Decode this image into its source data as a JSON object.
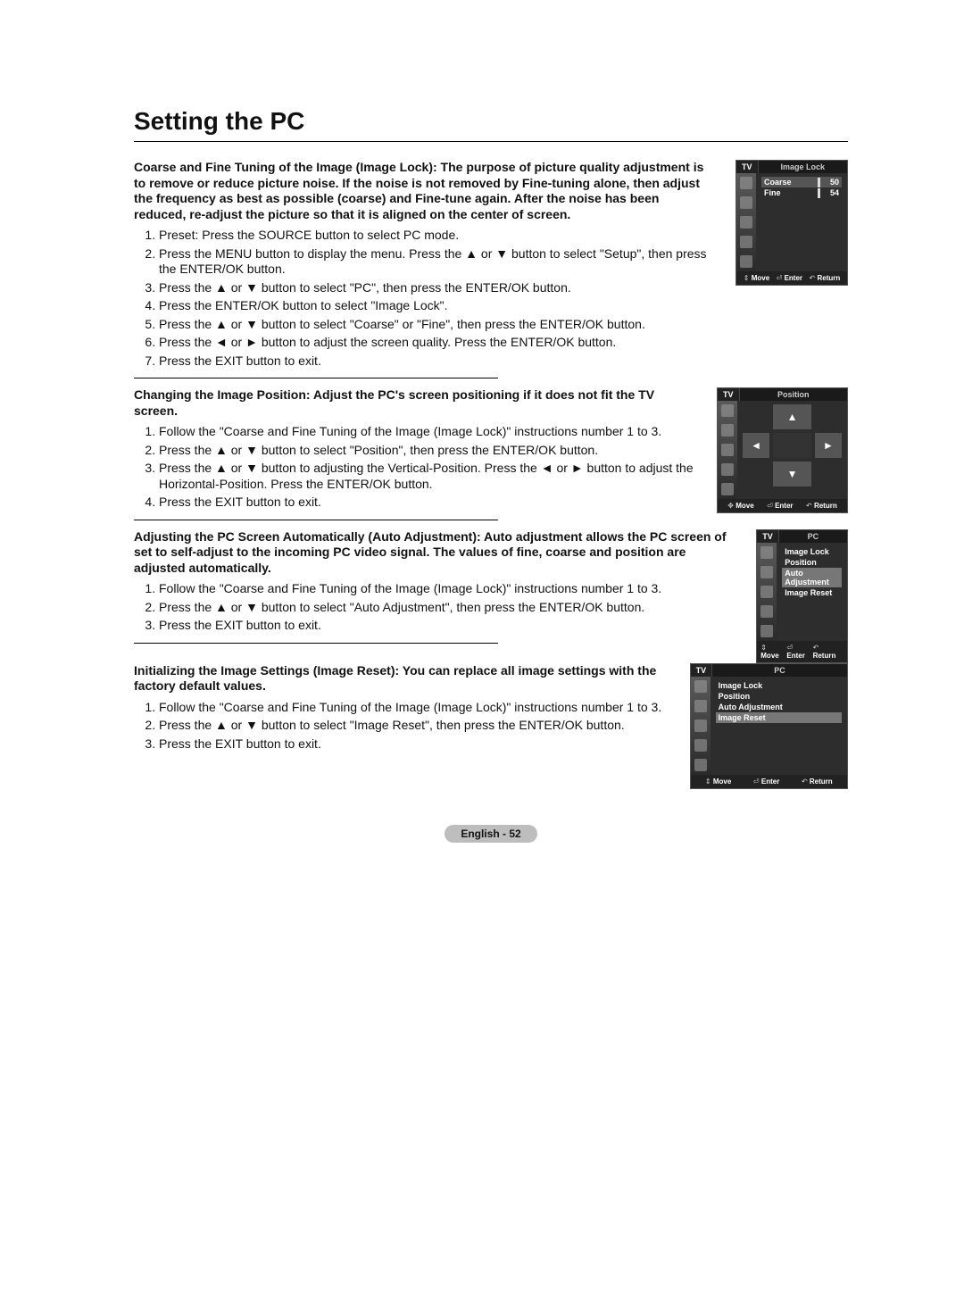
{
  "page_title": "Setting the PC",
  "page_footer": "English - 52",
  "osd": {
    "tv_label": "TV",
    "footer_move": "Move",
    "footer_enter": "Enter",
    "footer_return": "Return"
  },
  "sections": {
    "image_lock": {
      "lead": "Coarse and Fine Tuning of the Image (Image Lock):\nThe purpose of picture quality adjustment is to remove or reduce picture noise.\nIf the noise is not removed by Fine-tuning alone, then adjust the frequency as best as possible (coarse) and Fine-tune again.\nAfter the noise has been reduced, re-adjust the picture so that it is aligned on the center of screen.",
      "steps": [
        "Preset: Press the SOURCE button to select PC mode.",
        "Press the MENU button to display the menu. Press the ▲ or ▼ button to select \"Setup\", then press the ENTER/OK button.",
        "Press the ▲ or ▼ button to select \"PC\", then press the ENTER/OK button.",
        "Press the ENTER/OK button to select \"Image Lock\".",
        "Press the ▲ or ▼ button to select \"Coarse\" or \"Fine\", then press the ENTER/OK button.",
        "Press the ◄ or ► button to adjust the screen quality. Press the ENTER/OK button.",
        "Press the EXIT button to exit."
      ],
      "osd_title": "Image Lock",
      "coarse_label": "Coarse",
      "coarse_value": "50",
      "fine_label": "Fine",
      "fine_value": "54"
    },
    "position": {
      "lead": "Changing the Image Position:\nAdjust the PC's screen positioning if it does not fit the TV screen.",
      "steps": [
        "Follow the \"Coarse and Fine Tuning of the Image (Image Lock)\" instructions number 1 to 3.",
        "Press the ▲ or ▼ button to select \"Position\", then press the ENTER/OK button.",
        "Press the ▲ or ▼ button to adjusting the Vertical-Position. Press the ◄ or ► button to adjust the Horizontal-Position. Press the ENTER/OK button.",
        "Press the EXIT button to exit."
      ],
      "osd_title": "Position"
    },
    "auto_adjust": {
      "lead": "Adjusting the PC Screen Automatically (Auto Adjustment):\nAuto adjustment allows the PC screen of set to self-adjust to the incoming PC video signal. The values of fine, coarse and position are adjusted automatically.",
      "steps": [
        "Follow the \"Coarse and Fine Tuning of the Image (Image Lock)\" instructions number 1 to 3.",
        "Press the ▲ or ▼ button to select \"Auto Adjustment\", then press the ENTER/OK button.",
        "Press the EXIT button to exit."
      ],
      "osd_title": "PC",
      "menu": [
        "Image Lock",
        "Position",
        "Auto Adjustment",
        "Image Reset"
      ],
      "highlight": "Auto Adjustment"
    },
    "image_reset": {
      "lead": "Initializing the Image Settings (Image Reset):\nYou can replace all image settings with the factory default values.",
      "steps": [
        "Follow the \"Coarse and Fine Tuning of the Image (Image Lock)\" instructions number 1 to 3.",
        "Press the ▲ or ▼ button to select \"Image Reset\", then press the ENTER/OK button.",
        "Press the EXIT button to exit."
      ],
      "osd_title": "PC",
      "menu": [
        "Image Lock",
        "Position",
        "Auto Adjustment",
        "Image Reset"
      ],
      "highlight": "Image Reset"
    }
  }
}
